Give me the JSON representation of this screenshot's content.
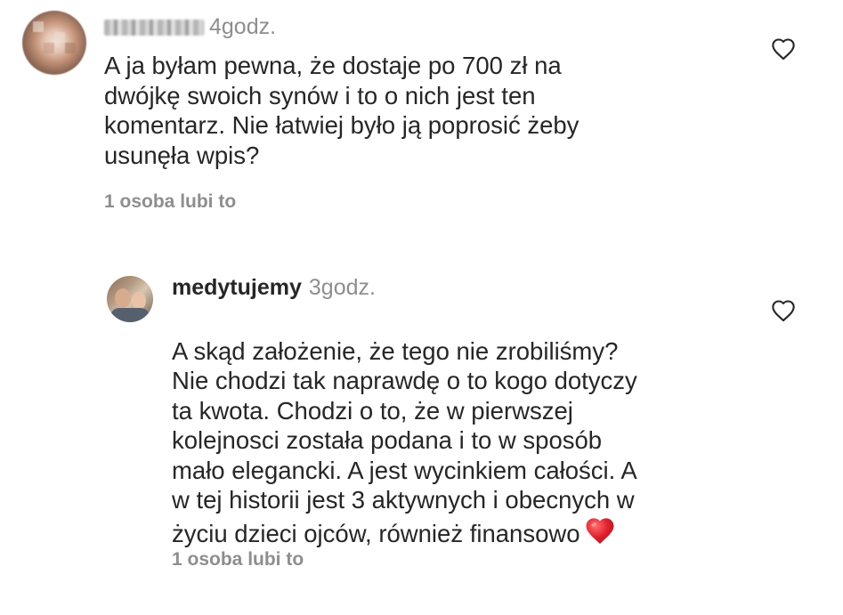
{
  "comments": [
    {
      "username": "",
      "username_blurred": true,
      "time": "4godz.",
      "text": "A ja byłam pewna, że dostaje po 700 zł na\ndwójkę swoich synów i to o nich jest ten\nkomentarz. Nie łatwiej było ją poprosić żeby\nusunęła wpis?",
      "likes": "1 osoba lubi to",
      "avatar": "blurred-avatar",
      "like_icon": "heart-outline-icon"
    },
    {
      "username": "medytujemy",
      "username_blurred": false,
      "time": "3godz.",
      "text": "A skąd założenie, że tego nie zrobiliśmy?\nNie chodzi tak naprawdę o to kogo dotyczy\nta kwota. Chodzi o to, że w pierwszej\nkolejnosci została podana i to w sposób\nmało elegancki. A jest wycinkiem całości. A\nw tej historii jest 3 aktywnych i obecnych w\nżyciu dzieci ojców, również finansowo",
      "emoji": "red-heart-emoji",
      "likes": "1 osoba lubi to",
      "avatar": "profile-photo-avatar",
      "like_icon": "heart-outline-icon"
    }
  ],
  "colors": {
    "text": "#262626",
    "secondary": "#8e8e8e",
    "heart_emoji": "#e0202e",
    "background": "#ffffff"
  }
}
